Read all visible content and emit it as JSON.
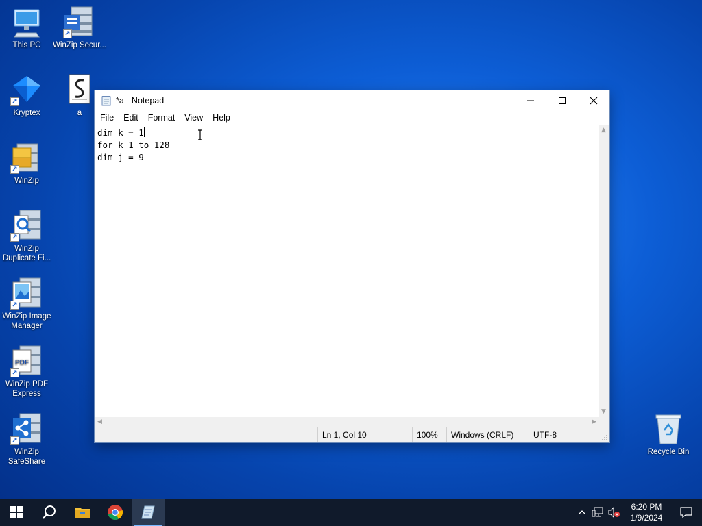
{
  "desktop": {
    "icons": [
      {
        "label": "This PC",
        "icon": "computer-icon"
      },
      {
        "label": "WinZip Secur...",
        "icon": "winzip-secure-icon"
      },
      {
        "label": "Kryptex",
        "icon": "kryptex-icon"
      },
      {
        "label": "a",
        "icon": "script-file-icon"
      },
      {
        "label": "WinZip",
        "icon": "winzip-icon"
      },
      {
        "label": "WinZip Duplicate Fi...",
        "icon": "winzip-duplicate-icon"
      },
      {
        "label": "WinZip Image Manager",
        "icon": "winzip-image-icon"
      },
      {
        "label": "WinZip PDF Express",
        "icon": "winzip-pdf-icon"
      },
      {
        "label": "WinZip SafeShare",
        "icon": "winzip-safeshare-icon"
      },
      {
        "label": "Recycle Bin",
        "icon": "recycle-bin-icon"
      }
    ]
  },
  "notepad": {
    "title": "*a - Notepad",
    "menu": [
      "File",
      "Edit",
      "Format",
      "View",
      "Help"
    ],
    "lines": [
      "dim k = 1",
      "for k 1 to 128",
      "dim j = 9"
    ],
    "status": {
      "position": "Ln 1, Col 10",
      "zoom": "100%",
      "line_ending": "Windows (CRLF)",
      "encoding": "UTF-8"
    }
  },
  "taskbar": {
    "clock_time": "6:20 PM",
    "clock_date": "1/9/2024"
  },
  "colors": {
    "desktop_bg": "#0d5ed6",
    "taskbar_bg": "#101a2b",
    "accent": "#7ab8ff"
  }
}
